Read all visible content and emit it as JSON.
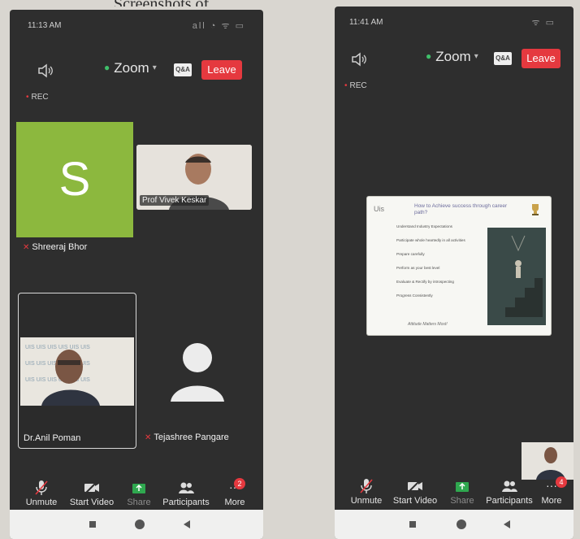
{
  "header": {
    "caption": "Screenshots of ..."
  },
  "left": {
    "status": {
      "time": "11:13 AM",
      "icons": "all ◔ ᯤ ▭"
    },
    "topbar": {
      "title": "Zoom",
      "qa": "Q&A",
      "leave": "Leave"
    },
    "rec": "REC",
    "participants": [
      {
        "name": "Shreeraj Bhor",
        "initial": "S",
        "muted": true
      },
      {
        "name": "Prof Vivek Keskar",
        "muted": false
      },
      {
        "name": "Dr.Anil Poman",
        "muted": false
      },
      {
        "name": "Tejashree Pangare",
        "muted": true
      }
    ],
    "toolbar": {
      "unmute": "Unmute",
      "start_video": "Start Video",
      "share": "Share",
      "participants": "Participants",
      "more": "More",
      "badge": "2"
    }
  },
  "right": {
    "status": {
      "time": "11:41 AM",
      "icons": "ᯤ ▭"
    },
    "topbar": {
      "title": "Zoom",
      "qa": "Q&A",
      "leave": "Leave"
    },
    "rec": "REC",
    "slide": {
      "logo": "Uis",
      "title": "How to Achieve success through career path?",
      "items": [
        "Understand Industry Expectations",
        "Participate whole heartedly in all activities",
        "Prepare carefully",
        "Perform as your best level",
        "Evaluate & Rectify by introspecting",
        "Progress Consistently"
      ],
      "quote": "Attitude Matters Most!"
    },
    "toolbar": {
      "unmute": "Unmute",
      "start_video": "Start Video",
      "share": "Share",
      "participants": "Participants",
      "more": "More",
      "badge": "4"
    }
  },
  "colors": {
    "accent_green": "#3fbf6a",
    "leave_red": "#e5393f",
    "avatar_green": "#8cb83e",
    "share_green": "#2fa84f"
  }
}
